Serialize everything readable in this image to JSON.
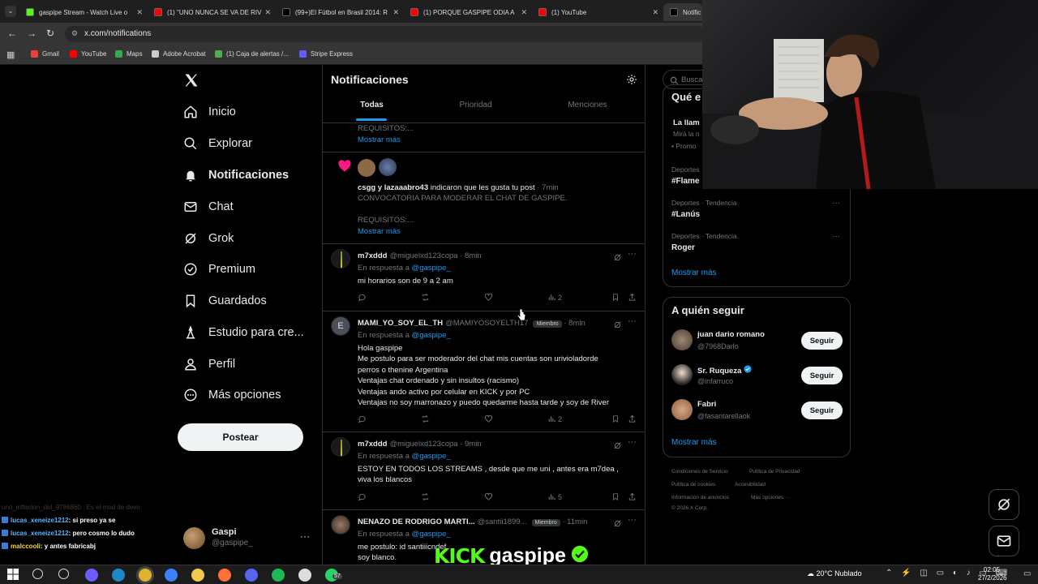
{
  "browser": {
    "tabs": [
      {
        "title": "gaspipe Stream - Watch Live o",
        "color": "#53fc18",
        "active": false
      },
      {
        "title": "(1) \"UNO NUNCA SE VA DE RIV",
        "color": "#ff0000",
        "active": false
      },
      {
        "title": "(99+)El Fútbol en Brasil 2014: R",
        "color": "#000000",
        "active": false
      },
      {
        "title": "(1) PORQUE GASPIPE ODIA A",
        "color": "#ff0000",
        "active": false
      },
      {
        "title": "(1) YouTube",
        "color": "#ff0000",
        "active": false
      },
      {
        "title": "Notific",
        "color": "#000000",
        "active": true
      }
    ],
    "url": "x.com/notifications",
    "bookmarks": [
      {
        "label": "Gmail",
        "color": "#ea4335"
      },
      {
        "label": "YouTube",
        "color": "#ff0000"
      },
      {
        "label": "Maps",
        "color": "#34a853"
      },
      {
        "label": "Adobe Acrobat",
        "color": "#cccccc"
      },
      {
        "label": "(1) Caja de alertas /...",
        "color": "#4caf50"
      },
      {
        "label": "Stripe Express",
        "color": "#635bff"
      }
    ]
  },
  "sidebar": {
    "items": [
      {
        "label": "Inicio",
        "icon": "home-icon"
      },
      {
        "label": "Explorar",
        "icon": "search-icon"
      },
      {
        "label": "Notificaciones",
        "icon": "bell-icon"
      },
      {
        "label": "Chat",
        "icon": "mail-icon"
      },
      {
        "label": "Grok",
        "icon": "grok-icon"
      },
      {
        "label": "Premium",
        "icon": "premium-icon"
      },
      {
        "label": "Guardados",
        "icon": "bookmark-icon"
      },
      {
        "label": "Estudio para cre...",
        "icon": "creator-studio-icon"
      },
      {
        "label": "Perfil",
        "icon": "person-icon"
      },
      {
        "label": "Más opciones",
        "icon": "more-circle-icon"
      }
    ],
    "post_label": "Postear",
    "account": {
      "name": "Gaspi",
      "handle": "@gaspipe_"
    }
  },
  "feed": {
    "title": "Notificaciones",
    "tabs": [
      "Todas",
      "Prioridad",
      "Menciones"
    ],
    "top_snippet": {
      "text": "REQUISITOS:...",
      "more": "Mostrar más"
    },
    "like_notif": {
      "users": "csgg y lazaaabro43",
      "action": " indicaron que les gusta tu post",
      "time": " · 7min",
      "line1": "CONVOCATORIA PARA MODERAR EL CHAT DE GASPIPE.",
      "line2": "REQUISITOS:...",
      "more": "Mostrar más"
    },
    "posts": [
      {
        "name": "m7xddd",
        "handle": "@miguelxd123copa",
        "time": " · 8min",
        "reply_prefix": "En respuesta a ",
        "reply_to": "@gaspipe_",
        "lines": [
          "mi horarios son de 9 a 2 am"
        ],
        "views": "2"
      },
      {
        "name": "MAMI_YO_SOY_EL_TH",
        "handle": "@MAMIYOSOYELTH17",
        "badge": "Miembro",
        "time": " · 8min",
        "reply_prefix": "En respuesta a ",
        "reply_to": "@gaspipe_",
        "lines": [
          "Hola gaspipe",
          "Me postulo para ser moderador del chat mis cuentas son urivioladorde",
          "perros o thenine Argentina",
          "Ventajas chat ordenado y sin insultos (racismo)",
          "Ventajas ando activo por celular en KICK y por PC",
          "Ventajas no soy marronazo y puedo quedarme hasta tarde y soy de River"
        ],
        "views": "2",
        "avatar_letter": "E"
      },
      {
        "name": "m7xddd",
        "handle": "@miguelxd123copa",
        "time": " · 9min",
        "reply_prefix": "En respuesta a ",
        "reply_to": "@gaspipe_",
        "lines": [
          "ESTOY EN TODOS LOS STREAMS , desde que me uni , antes era m7dea ,",
          "viva los blancos"
        ],
        "views": "5"
      },
      {
        "name": "NENAZO DE RODRIGO MARTI...",
        "handle": "@santii1899...",
        "badge": "Miembro",
        "time": " · 11min",
        "reply_prefix": "En respuesta a ",
        "reply_to": "@gaspipe_",
        "lines": [
          "me postulo: id santiiicndef",
          "soy blanco."
        ]
      }
    ]
  },
  "right": {
    "search_placeholder": "Busca",
    "trends_title": "Qué e",
    "promo": {
      "title": "La llam",
      "sub": "Mirá la n",
      "tag": "Promo"
    },
    "trends": [
      {
        "category": "Deportes ·",
        "name": "#Flame"
      },
      {
        "category": "Deportes · Tendencia",
        "name": "#Lanús"
      },
      {
        "category": "Deportes · Tendencia",
        "name": "Roger"
      }
    ],
    "show_more": "Mostrar más",
    "who_to_follow": "A quién seguir",
    "follow": [
      {
        "name": "juan dario romano",
        "handle": "@7968Darlo",
        "verified": false
      },
      {
        "name": "Sr. Ruqueza",
        "handle": "@infarruco",
        "verified": true
      },
      {
        "name": "Fabri",
        "handle": "@fasantarellaok",
        "verified": false
      }
    ],
    "follow_label": "Seguir",
    "footer": [
      "Condiciones de Servicio",
      "Política de Privacidad",
      "Política de cookies",
      "Accesibilidad",
      "Información de anuncios",
      "Más opciones ···",
      "© 2026 X Corp."
    ]
  },
  "overlay": {
    "chat": [
      {
        "user": "lucas_xeneize1212",
        "msg": ": si preso ya se",
        "color": "#5db6ff"
      },
      {
        "user": "lucas_xeneize1212",
        "msg": ": pero cosmo lo dudo",
        "color": "#5db6ff"
      },
      {
        "user": "malccooli",
        "msg": ": y antes fabricabj",
        "color": "#f5d547"
      }
    ],
    "faded_line": "uno_inflacion_del_9786860 : Es el mod de devo",
    "brand": {
      "kick": "KICK",
      "name": "gaspipe"
    }
  },
  "taskbar": {
    "weather": "20°C  Nublado",
    "time": "02:05",
    "date": "27/2/2026",
    "whatsapp_badge": "57"
  }
}
